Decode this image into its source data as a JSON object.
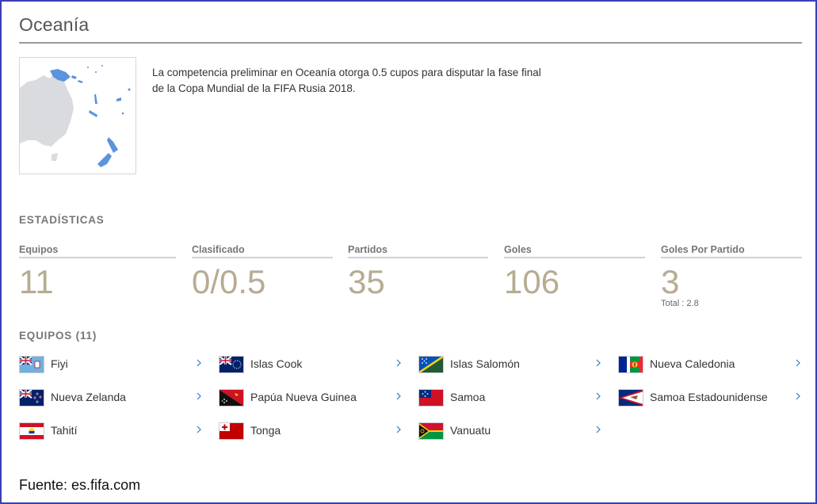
{
  "region": {
    "title": "Oceanía",
    "description": "La competencia preliminar en Oceanía otorga 0.5 cupos para disputar la fase final de la Copa Mundial de la FIFA Rusia 2018."
  },
  "stats": {
    "heading": "ESTADÍSTICAS",
    "items": [
      {
        "label": "Equipos",
        "value": "11"
      },
      {
        "label": "Clasificado",
        "value": "0/0.5"
      },
      {
        "label": "Partidos",
        "value": "35"
      },
      {
        "label": "Goles",
        "value": "106"
      },
      {
        "label": "Goles Por Partido",
        "value": "3",
        "sub": "Total : 2.8"
      }
    ]
  },
  "teams": {
    "heading": "EQUIPOS (11)",
    "items": [
      {
        "name": "Fiyi",
        "flag": "fiji-flag"
      },
      {
        "name": "Islas Cook",
        "flag": "cook-islands-flag"
      },
      {
        "name": "Islas Salomón",
        "flag": "solomon-islands-flag"
      },
      {
        "name": "Nueva Caledonia",
        "flag": "new-caledonia-flag"
      },
      {
        "name": "Nueva Zelanda",
        "flag": "new-zealand-flag"
      },
      {
        "name": "Papúa Nueva Guinea",
        "flag": "papua-new-guinea-flag"
      },
      {
        "name": "Samoa",
        "flag": "samoa-flag"
      },
      {
        "name": "Samoa Estadounidense",
        "flag": "american-samoa-flag"
      },
      {
        "name": "Tahití",
        "flag": "tahiti-flag"
      },
      {
        "name": "Tonga",
        "flag": "tonga-flag"
      },
      {
        "name": "Vanuatu",
        "flag": "vanuatu-flag"
      }
    ]
  },
  "source": "Fuente: es.fifa.com",
  "colors": {
    "frame": "#3a3fb4",
    "stat_value": "#b7ab92",
    "map_highlight": "#5b93dc",
    "map_land": "#d9dbde",
    "chevron": "#2f7ad8"
  }
}
